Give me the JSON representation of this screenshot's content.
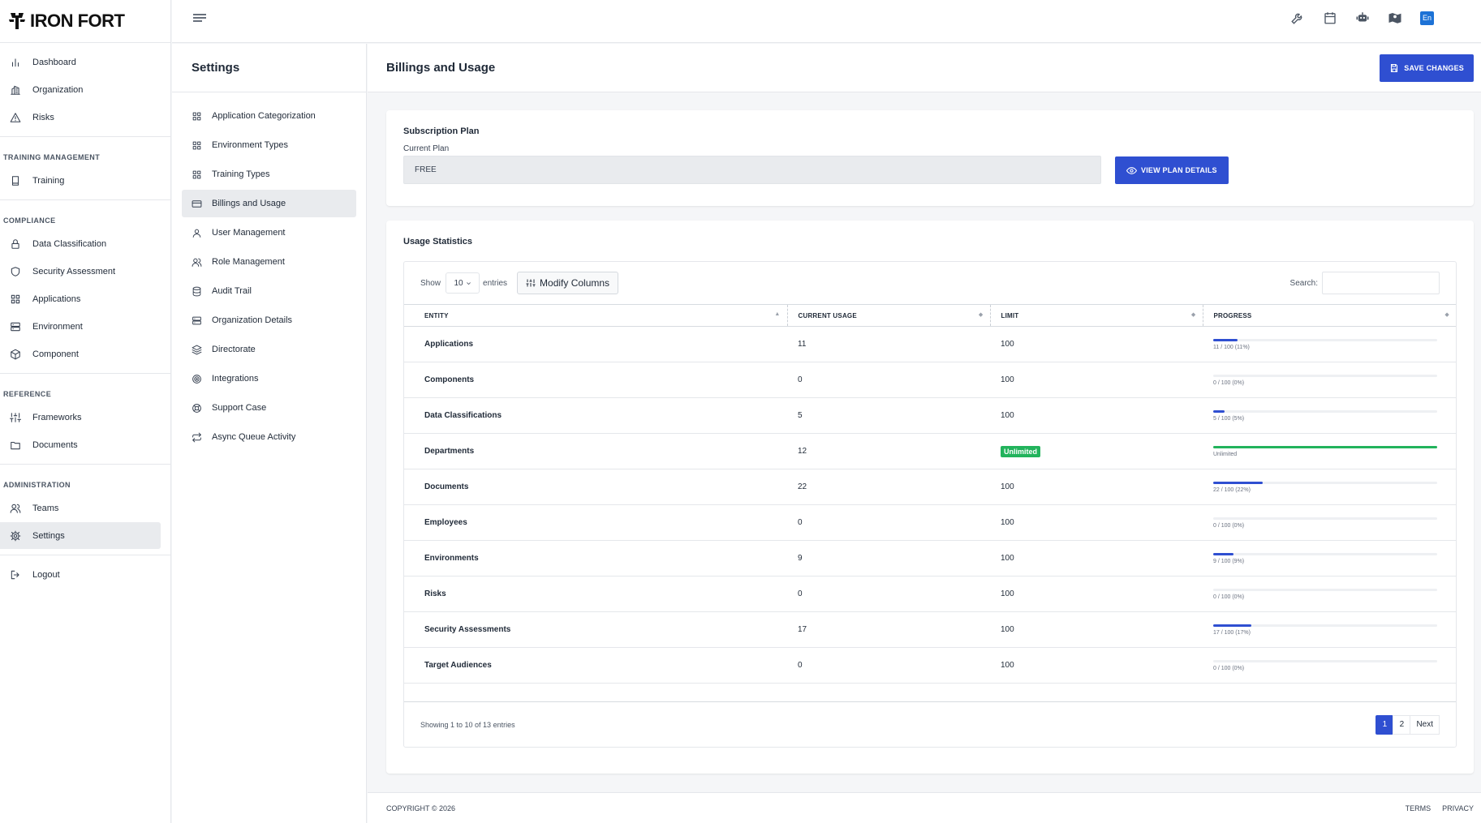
{
  "brand": {
    "name": "IRON FORT"
  },
  "sidebar": {
    "groups": [
      {
        "heading": "",
        "items": [
          {
            "label": "Dashboard",
            "icon": "chart-icon"
          },
          {
            "label": "Organization",
            "icon": "organization-icon"
          },
          {
            "label": "Risks",
            "icon": "warning-icon"
          }
        ]
      },
      {
        "heading": "TRAINING MANAGEMENT",
        "items": [
          {
            "label": "Training",
            "icon": "book-icon"
          }
        ]
      },
      {
        "heading": "COMPLIANCE",
        "items": [
          {
            "label": "Data Classification",
            "icon": "lock-icon"
          },
          {
            "label": "Security Assessment",
            "icon": "shield-icon"
          },
          {
            "label": "Applications",
            "icon": "grid-icon"
          },
          {
            "label": "Environment",
            "icon": "server-icon"
          },
          {
            "label": "Component",
            "icon": "cube-icon"
          }
        ]
      },
      {
        "heading": "REFERENCE",
        "items": [
          {
            "label": "Frameworks",
            "icon": "sliders-icon"
          },
          {
            "label": "Documents",
            "icon": "folder-icon"
          }
        ]
      },
      {
        "heading": "ADMINISTRATION",
        "items": [
          {
            "label": "Teams",
            "icon": "users-icon"
          },
          {
            "label": "Settings",
            "icon": "gear-icon",
            "active": true
          }
        ]
      },
      {
        "heading": "",
        "items": [
          {
            "label": "Logout",
            "icon": "logout-icon"
          }
        ]
      }
    ]
  },
  "topbar": {
    "language": "En"
  },
  "settings": {
    "title": "Settings",
    "items": [
      {
        "label": "Application Categorization",
        "icon": "grid-icon"
      },
      {
        "label": "Environment Types",
        "icon": "grid-icon"
      },
      {
        "label": "Training Types",
        "icon": "grid-icon"
      },
      {
        "label": "Billings and Usage",
        "icon": "credit-card-icon",
        "active": true
      },
      {
        "label": "User Management",
        "icon": "user-icon"
      },
      {
        "label": "Role Management",
        "icon": "users-icon"
      },
      {
        "label": "Audit Trail",
        "icon": "database-icon"
      },
      {
        "label": "Organization Details",
        "icon": "server-icon"
      },
      {
        "label": "Directorate",
        "icon": "layers-icon"
      },
      {
        "label": "Integrations",
        "icon": "target-icon"
      },
      {
        "label": "Support Case",
        "icon": "lifebuoy-icon"
      },
      {
        "label": "Async Queue Activity",
        "icon": "repeat-icon"
      }
    ]
  },
  "page": {
    "title": "Billings and Usage",
    "save_label": "SAVE CHANGES"
  },
  "plan": {
    "title": "Subscription Plan",
    "current_label": "Current Plan",
    "current_value": "FREE",
    "view_label": "VIEW PLAN DETAILS"
  },
  "usage": {
    "title": "Usage Statistics",
    "show_label": "Show",
    "page_size": "10",
    "entries_label": "entries",
    "modify_label": "Modify Columns",
    "search_label": "Search:",
    "columns": [
      "ENTITY",
      "CURRENT USAGE",
      "LIMIT",
      "PROGRESS"
    ],
    "rows": [
      {
        "entity": "Applications",
        "usage": "11",
        "limit": "100",
        "progress_text": "11 / 100 (11%)",
        "percent": 11,
        "unlimited": false
      },
      {
        "entity": "Components",
        "usage": "0",
        "limit": "100",
        "progress_text": "0 / 100 (0%)",
        "percent": 0,
        "unlimited": false
      },
      {
        "entity": "Data Classifications",
        "usage": "5",
        "limit": "100",
        "progress_text": "5 / 100 (5%)",
        "percent": 5,
        "unlimited": false
      },
      {
        "entity": "Departments",
        "usage": "12",
        "limit": "Unlimited",
        "progress_text": "Unlimited",
        "percent": 100,
        "unlimited": true
      },
      {
        "entity": "Documents",
        "usage": "22",
        "limit": "100",
        "progress_text": "22 / 100 (22%)",
        "percent": 22,
        "unlimited": false
      },
      {
        "entity": "Employees",
        "usage": "0",
        "limit": "100",
        "progress_text": "0 / 100 (0%)",
        "percent": 0,
        "unlimited": false
      },
      {
        "entity": "Environments",
        "usage": "9",
        "limit": "100",
        "progress_text": "9 / 100 (9%)",
        "percent": 9,
        "unlimited": false
      },
      {
        "entity": "Risks",
        "usage": "0",
        "limit": "100",
        "progress_text": "0 / 100 (0%)",
        "percent": 0,
        "unlimited": false
      },
      {
        "entity": "Security Assessments",
        "usage": "17",
        "limit": "100",
        "progress_text": "17 / 100 (17%)",
        "percent": 17,
        "unlimited": false
      },
      {
        "entity": "Target Audiences",
        "usage": "0",
        "limit": "100",
        "progress_text": "0 / 100 (0%)",
        "percent": 0,
        "unlimited": false
      }
    ],
    "info": "Showing 1 to 10 of 13 entries",
    "pages": [
      "1",
      "2"
    ],
    "next_label": "Next"
  },
  "footer": {
    "copyright": "COPYRIGHT © 2026",
    "terms": "TERMS",
    "privacy": "PRIVACY"
  },
  "colors": {
    "primary": "#2f4fd1",
    "success": "#22b35c",
    "language_badge": "#1d72d6"
  }
}
